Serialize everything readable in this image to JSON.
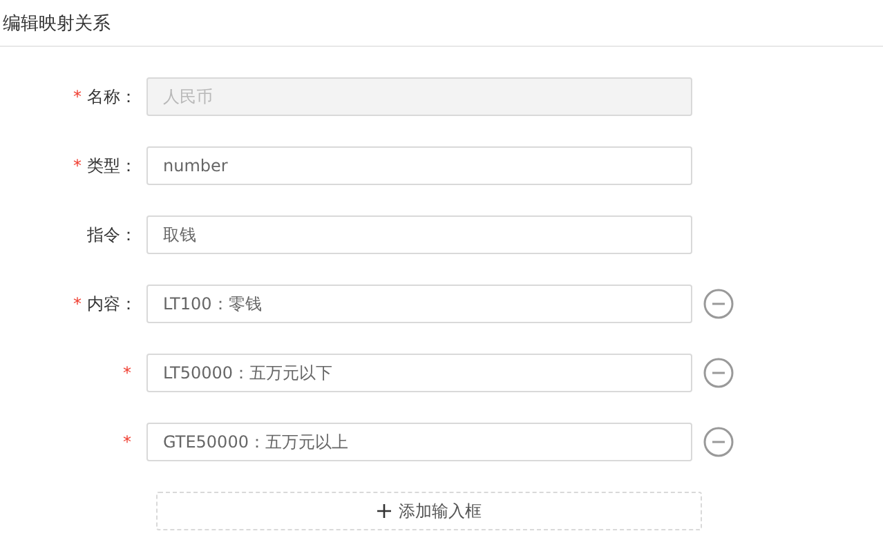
{
  "title": "编辑映射关系",
  "fields": [
    {
      "required_mark": "*",
      "label": "名称：",
      "value": "人民币",
      "disabled": true,
      "removable": false
    },
    {
      "required_mark": "*",
      "label": "类型：",
      "value": "number",
      "disabled": false,
      "removable": false
    },
    {
      "label": "指令：",
      "value": "取钱",
      "disabled": false,
      "removable": false
    },
    {
      "required_mark": "*",
      "label": "内容：",
      "value": "LT100：零钱",
      "disabled": false,
      "removable": true
    },
    {
      "required_mark": "*",
      "value": "LT50000：五万元以下",
      "disabled": false,
      "removable": true
    },
    {
      "required_mark": "*",
      "value": "GTE50000：五万元以上",
      "disabled": false,
      "removable": true
    }
  ],
  "add_button": "添加输入框"
}
